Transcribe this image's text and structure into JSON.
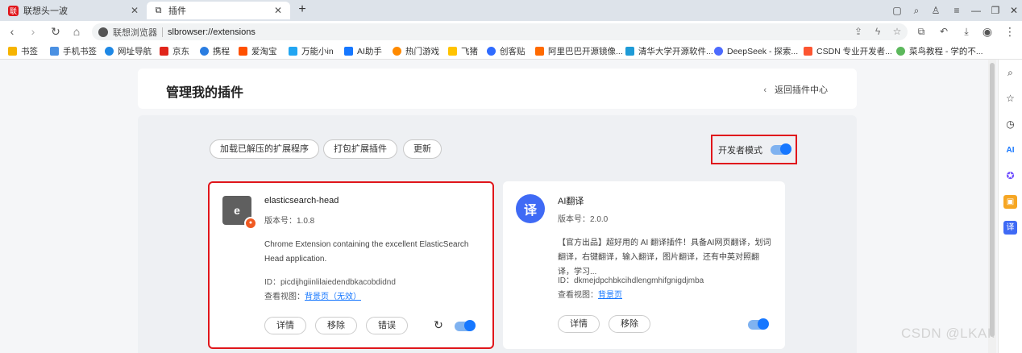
{
  "tabs": [
    {
      "label": "联想头一波",
      "favicon_color": "#e0161b",
      "active": false
    },
    {
      "label": "插件",
      "favicon_color": "#ffffff",
      "active": true
    }
  ],
  "new_tab_label": "+",
  "address": {
    "site_name": "联想浏览器",
    "url": "slbrowser://extensions"
  },
  "bookmarks": [
    {
      "label": "书签",
      "color": "#f6b400"
    },
    {
      "label": "手机书签",
      "color": "#4a90e2"
    },
    {
      "label": "网址导航",
      "color": "#1e88e5"
    },
    {
      "label": "京东",
      "color": "#e1251b"
    },
    {
      "label": "携程",
      "color": "#2a7de1"
    },
    {
      "label": "爱淘宝",
      "color": "#ff5000"
    },
    {
      "label": "万能小in",
      "color": "#22a6f2"
    },
    {
      "label": "AI助手",
      "color": "#1677ff"
    },
    {
      "label": "热门游戏",
      "color": "#ff8a00"
    },
    {
      "label": "飞猪",
      "color": "#ffc300"
    },
    {
      "label": "创客贴",
      "color": "#2f6bff"
    },
    {
      "label": "阿里巴巴开源镜像...",
      "color": "#ff6a00"
    },
    {
      "label": "清华大学开源软件...",
      "color": "#1e9bd7"
    },
    {
      "label": "DeepSeek - 探索...",
      "color": "#4d6bfe"
    },
    {
      "label": "CSDN 专业开发者...",
      "color": "#fc5531"
    },
    {
      "label": "菜鸟教程 - 学的不...",
      "color": "#5cb85c"
    }
  ],
  "page": {
    "title": "管理我的插件",
    "back_label": "返回插件中心",
    "actions": {
      "load_unpacked": "加载已解压的扩展程序",
      "pack": "打包扩展插件",
      "update": "更新"
    },
    "dev_mode_label": "开发者模式",
    "dev_mode_on": true
  },
  "extensions": [
    {
      "name": "elasticsearch-head",
      "logo_letter": "e",
      "logo_color": "#5f5f5f",
      "version": "版本号：1.0.8",
      "description": "Chrome Extension containing the excellent ElasticSearch Head application.",
      "id": "ID：picdijhgiinlilaiedendbkacobdidnd",
      "views_label": "查看视图：",
      "views_link": "背景页（无效）",
      "buttons": {
        "details": "详情",
        "remove": "移除",
        "errors": "错误"
      },
      "enabled": true
    },
    {
      "name": "AI翻译",
      "logo_letter": "译",
      "logo_color": "#3f6af5",
      "version": "版本号：2.0.0",
      "description": "【官方出品】超好用的 AI 翻译插件！具备AI网页翻译，划词翻译，右键翻译，输入翻译，图片翻译，还有中英对照翻译，学习...",
      "id": "ID：dkmejdpchbkcihdlengmhifgnigdjmba",
      "views_label": "查看视图：",
      "views_link": "背景页",
      "buttons": {
        "details": "详情",
        "remove": "移除"
      },
      "enabled": true
    }
  ],
  "watermark": "CSDN @LKAI."
}
